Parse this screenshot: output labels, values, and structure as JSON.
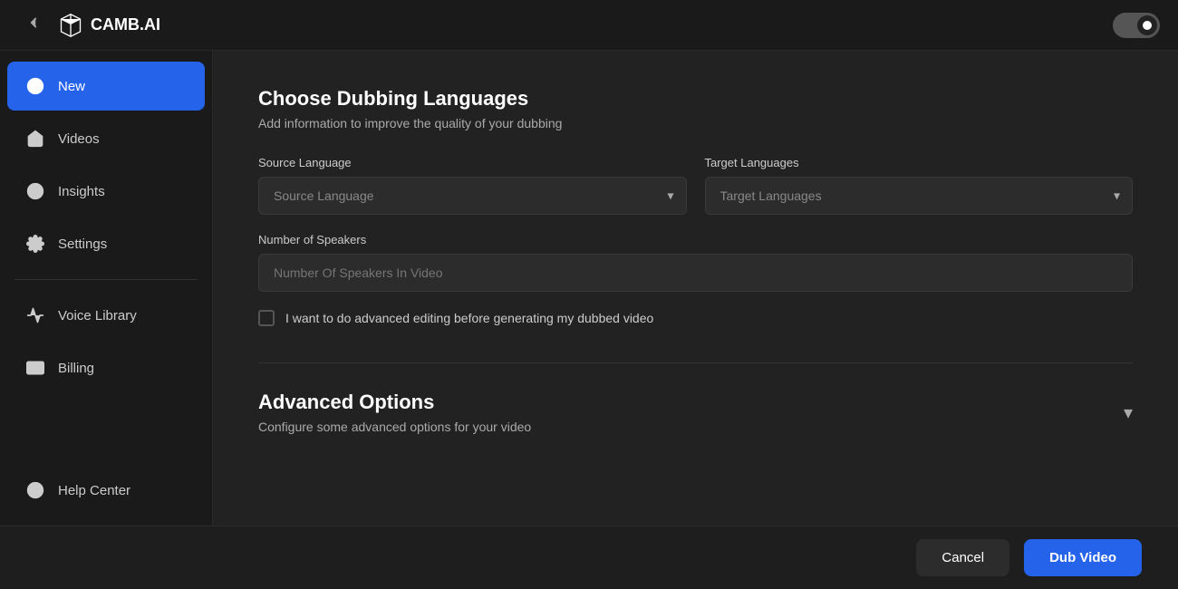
{
  "topbar": {
    "back_icon": "chevron-left",
    "logo_text": "CAMB.AI",
    "toggle_state": "on"
  },
  "sidebar": {
    "items": [
      {
        "id": "new",
        "label": "New",
        "icon": "plus-circle",
        "active": true
      },
      {
        "id": "videos",
        "label": "Videos",
        "icon": "home"
      },
      {
        "id": "insights",
        "label": "Insights",
        "icon": "circle-dot"
      },
      {
        "id": "settings",
        "label": "Settings",
        "icon": "settings"
      },
      {
        "id": "voice-library",
        "label": "Voice Library",
        "icon": "waveform"
      },
      {
        "id": "billing",
        "label": "Billing",
        "icon": "credit-card"
      }
    ],
    "bottom_items": [
      {
        "id": "help-center",
        "label": "Help Center",
        "icon": "help-circle"
      }
    ]
  },
  "main": {
    "section_dubbing": {
      "title": "Choose Dubbing Languages",
      "subtitle": "Add information to improve the quality of your dubbing",
      "source_language": {
        "label": "Source Language",
        "placeholder": "Source Language"
      },
      "target_languages": {
        "label": "Target Languages",
        "placeholder": "Target Languages"
      },
      "num_speakers": {
        "label": "Number of Speakers",
        "placeholder": "Number Of Speakers In Video"
      },
      "checkbox_label": "I want to do advanced editing before generating my dubbed video"
    },
    "section_advanced": {
      "title": "Advanced Options",
      "subtitle": "Configure some advanced options for your video"
    }
  },
  "footer": {
    "cancel_label": "Cancel",
    "dub_label": "Dub Video"
  }
}
